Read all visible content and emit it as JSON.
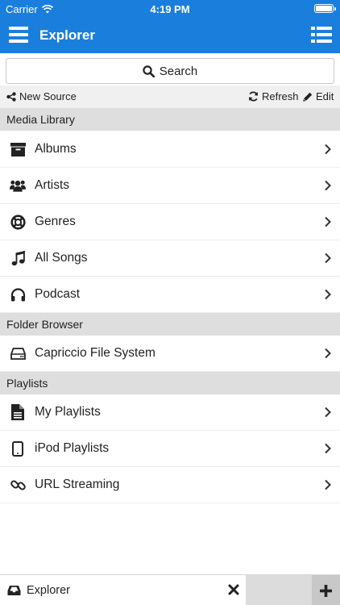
{
  "status_bar": {
    "carrier": "Carrier",
    "time": "4:19 PM"
  },
  "nav_bar": {
    "title": "Explorer",
    "left_icon": "hamburger-menu-icon",
    "right_icon": "list-icon",
    "color": "#1a7fdc"
  },
  "search": {
    "label": "Search",
    "icon": "search-icon"
  },
  "toolbar": {
    "new_source": "New Source",
    "refresh": "Refresh",
    "edit": "Edit"
  },
  "sections": {
    "media_library": {
      "title": "Media Library",
      "items": [
        {
          "label": "Albums",
          "icon": "archive-box-icon"
        },
        {
          "label": "Artists",
          "icon": "users-icon"
        },
        {
          "label": "Genres",
          "icon": "life-ring-icon"
        },
        {
          "label": "All Songs",
          "icon": "music-note-icon"
        },
        {
          "label": "Podcast",
          "icon": "headphones-icon"
        }
      ]
    },
    "folder_browser": {
      "title": "Folder Browser",
      "items": [
        {
          "label": "Capriccio File System",
          "icon": "hard-drive-icon"
        }
      ]
    },
    "playlists": {
      "title": "Playlists",
      "items": [
        {
          "label": "My Playlists",
          "icon": "document-icon"
        },
        {
          "label": "iPod Playlists",
          "icon": "tablet-icon"
        },
        {
          "label": "URL Streaming",
          "icon": "link-icon"
        }
      ]
    }
  },
  "bottom_tabs": {
    "active_tab": "Explorer",
    "active_icon": "inbox-icon",
    "close_icon": "close-icon",
    "add_icon": "plus-icon"
  }
}
